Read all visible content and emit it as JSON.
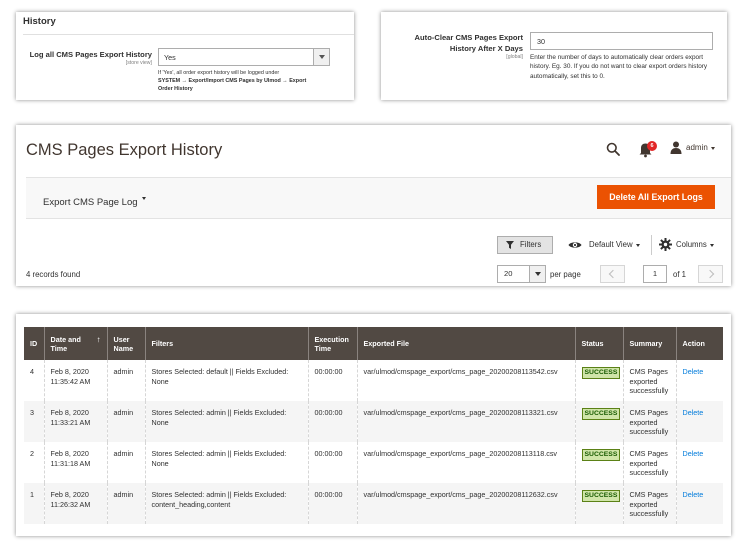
{
  "history_config": {
    "section_title": "History",
    "log_label": "Log all CMS Pages Export History",
    "log_scope": "[store view]",
    "log_value": "Yes",
    "note_text": "If 'Yes', all order export history will be logged under",
    "note_path": "SYSTEM → Export/Import CMS Pages by Ulmod → Export Order History"
  },
  "autoclear_config": {
    "label": "Auto-Clear CMS Pages Export History After X Days",
    "scope": "[global]",
    "value": "30",
    "note": "Enter the number of days to automatically clear orders export history. Eg. 30. If you do not want to clear export orders history automatically, set this to 0."
  },
  "header": {
    "page_title": "CMS Pages Export History",
    "notification_count": "6",
    "user_name": "admin"
  },
  "actions": {
    "export_dropdown": "Export CMS Page Log",
    "delete_all": "Delete All Export Logs"
  },
  "toolbar": {
    "filters": "Filters",
    "default_view": "Default View",
    "columns": "Columns",
    "records_found": "4 records found",
    "per_page_value": "20",
    "per_page_label": "per page",
    "current_page": "1",
    "of_pages": "of 1"
  },
  "grid": {
    "columns": [
      "ID",
      "Date and Time",
      "User Name",
      "Filters",
      "Execution Time",
      "Exported File",
      "Status",
      "Summary",
      "Action"
    ],
    "sort_arrow": "↑",
    "rows": [
      {
        "id": "4",
        "date": "Feb 8, 2020 11:35:42 AM",
        "user": "admin",
        "filters": "Stores Selected: default || Fields Excluded: None",
        "exec": "00:00:00",
        "file": "var/ulmod/cmspage_export/cms_page_20200208113542.csv",
        "status": "SUCCESS",
        "summary": "CMS Pages exported successfully",
        "action": "Delete"
      },
      {
        "id": "3",
        "date": "Feb 8, 2020 11:33:21 AM",
        "user": "admin",
        "filters": "Stores Selected: admin || Fields Excluded: None",
        "exec": "00:00:00",
        "file": "var/ulmod/cmspage_export/cms_page_20200208113321.csv",
        "status": "SUCCESS",
        "summary": "CMS Pages exported successfully",
        "action": "Delete"
      },
      {
        "id": "2",
        "date": "Feb 8, 2020 11:31:18 AM",
        "user": "admin",
        "filters": "Stores Selected: admin || Fields Excluded: None",
        "exec": "00:00:00",
        "file": "var/ulmod/cmspage_export/cms_page_20200208113118.csv",
        "status": "SUCCESS",
        "summary": "CMS Pages exported successfully",
        "action": "Delete"
      },
      {
        "id": "1",
        "date": "Feb 8, 2020 11:26:32 AM",
        "user": "admin",
        "filters": "Stores Selected: admin || Fields Excluded: content_heading,content",
        "exec": "00:00:00",
        "file": "var/ulmod/cmspage_export/cms_page_20200208112632.csv",
        "status": "SUCCESS",
        "summary": "CMS Pages exported successfully",
        "action": "Delete"
      }
    ]
  },
  "colors": {
    "accent": "#eb5202",
    "table_header": "#514943",
    "link": "#007bdb",
    "success_bg": "#d0e5a9",
    "badge": "#e22626"
  },
  "icons": [
    "search-icon",
    "bell-icon",
    "user-icon",
    "funnel-icon",
    "eye-icon",
    "gear-icon"
  ]
}
